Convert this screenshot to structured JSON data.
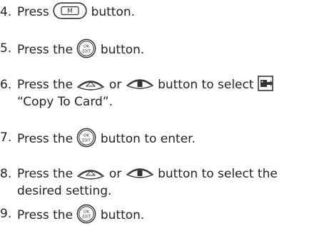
{
  "steps": [
    {
      "number": "4.",
      "parts": {
        "a": "Press",
        "icon": "mode-m-button-icon",
        "b": "button."
      }
    },
    {
      "number": "5.",
      "parts": {
        "a": "Press the",
        "icon": "ok-edit-button-icon",
        "b": "button."
      }
    },
    {
      "number": "6.",
      "parts": {
        "a": "Press the",
        "icon1": "up-arrow-button-icon",
        "or": "or",
        "icon2": "down-trash-button-icon",
        "b": "button to select",
        "icon3": "copy-to-card-icon",
        "line2": "“Copy To Card”."
      }
    },
    {
      "number": "7.",
      "parts": {
        "a": "Press the",
        "icon": "ok-edit-button-icon",
        "b": "button to enter."
      }
    },
    {
      "number": "8.",
      "parts": {
        "a": "Press the",
        "icon1": "up-arrow-button-icon",
        "or": "or",
        "icon2": "down-trash-button-icon",
        "b": "button to select the",
        "line2": "desired setting."
      }
    },
    {
      "number": "9.",
      "parts": {
        "a": "Press the",
        "icon": "ok-edit-button-icon",
        "b": "button."
      }
    }
  ],
  "icon_labels": {
    "mode": "M",
    "ok": "OK",
    "edit": "EDIT"
  }
}
